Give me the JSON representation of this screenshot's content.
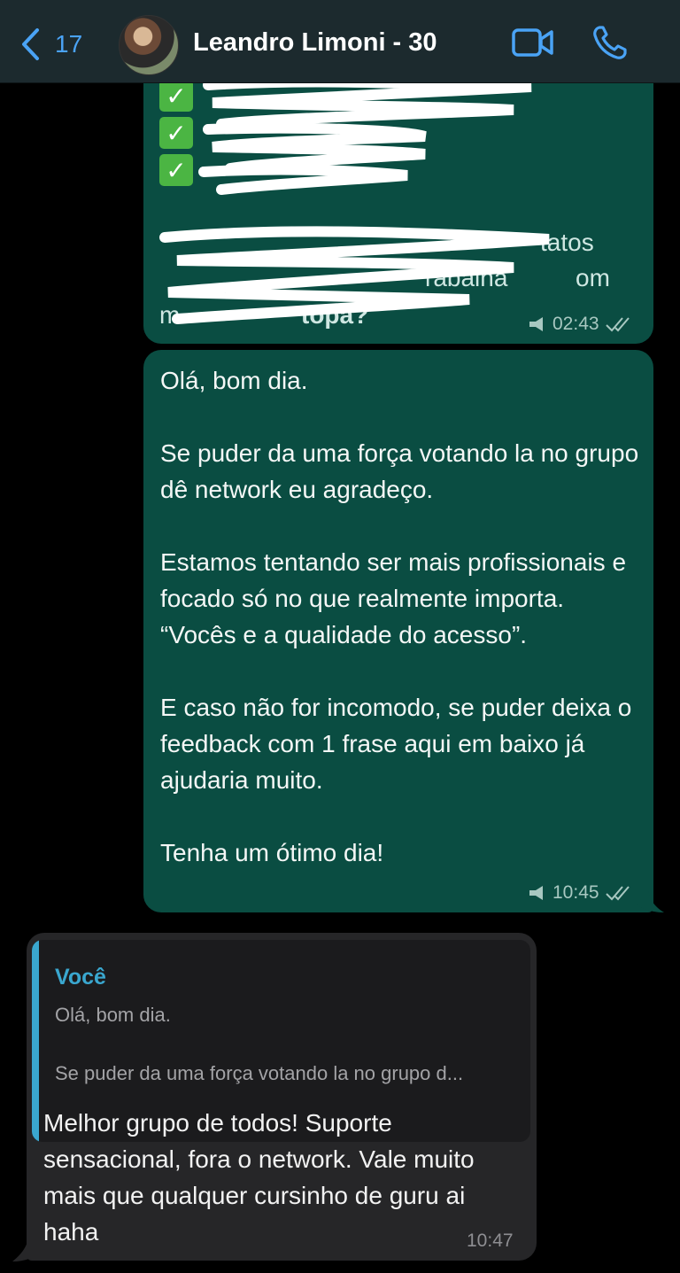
{
  "header": {
    "back_count": "17",
    "contact_name": "Leandro Limoni - 30"
  },
  "messages": [
    {
      "direction": "outgoing",
      "redacted": true,
      "visible_fragments": [
        "tatos",
        "rabalha",
        "om",
        "m",
        "topa?"
      ],
      "time": "02:43"
    },
    {
      "direction": "outgoing",
      "paragraphs": [
        "Olá, bom dia.",
        "",
        "Se puder da uma força votando la no grupo dê network eu agradeço.",
        "",
        "Estamos tentando ser mais profissionais e focado só no que realmente importa. “Vocês e a qualidade do acesso”.",
        "",
        "E caso não for incomodo, se puder deixa o feedback com 1 frase aqui em baixo já ajudaria muito.",
        "",
        "Tenha um ótimo dia!"
      ],
      "time": "10:45"
    },
    {
      "direction": "incoming",
      "quote": {
        "author": "Você",
        "line1": "Olá, bom dia.",
        "line2": "Se puder da uma força votando la no grupo d..."
      },
      "text": "Melhor grupo de todos! Suporte sensacional, fora o network. Vale muito mais que qualquer cursinho de guru ai haha",
      "time": "10:47"
    }
  ],
  "colors": {
    "header_bg": "#1c2a2e",
    "outgoing_bubble": "#0a4d42",
    "incoming_bubble": "#262628",
    "accent_blue": "#4aa3f5",
    "quote_accent": "#3aa7cf"
  }
}
